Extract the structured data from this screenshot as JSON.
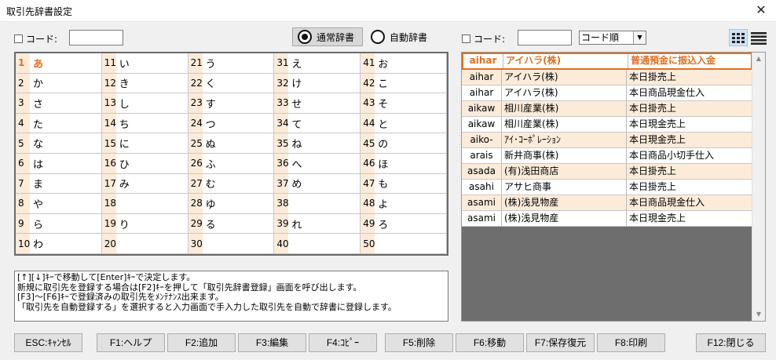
{
  "window": {
    "title": "取引先辞書設定",
    "close": "✕"
  },
  "left_filter": {
    "label": "コード:",
    "value": ""
  },
  "mode": {
    "normal": "通常辞書",
    "auto": "自動辞書"
  },
  "right_filter": {
    "label": "コード:",
    "value": "",
    "sort": "コード順"
  },
  "kana_columns": [
    [
      {
        "n": "1",
        "k": "あ"
      },
      {
        "n": "2",
        "k": "か"
      },
      {
        "n": "3",
        "k": "さ"
      },
      {
        "n": "4",
        "k": "た"
      },
      {
        "n": "5",
        "k": "な"
      },
      {
        "n": "6",
        "k": "は"
      },
      {
        "n": "7",
        "k": "ま"
      },
      {
        "n": "8",
        "k": "や"
      },
      {
        "n": "9",
        "k": "ら"
      },
      {
        "n": "10",
        "k": "わ"
      }
    ],
    [
      {
        "n": "11",
        "k": "い"
      },
      {
        "n": "12",
        "k": "き"
      },
      {
        "n": "13",
        "k": "し"
      },
      {
        "n": "14",
        "k": "ち"
      },
      {
        "n": "15",
        "k": "に"
      },
      {
        "n": "16",
        "k": "ひ"
      },
      {
        "n": "17",
        "k": "み"
      },
      {
        "n": "18",
        "k": ""
      },
      {
        "n": "19",
        "k": "り"
      },
      {
        "n": "20",
        "k": ""
      }
    ],
    [
      {
        "n": "21",
        "k": "う"
      },
      {
        "n": "22",
        "k": "く"
      },
      {
        "n": "23",
        "k": "す"
      },
      {
        "n": "24",
        "k": "つ"
      },
      {
        "n": "25",
        "k": "ぬ"
      },
      {
        "n": "26",
        "k": "ふ"
      },
      {
        "n": "27",
        "k": "む"
      },
      {
        "n": "28",
        "k": "ゆ"
      },
      {
        "n": "29",
        "k": "る"
      },
      {
        "n": "30",
        "k": ""
      }
    ],
    [
      {
        "n": "31",
        "k": "え"
      },
      {
        "n": "32",
        "k": "け"
      },
      {
        "n": "33",
        "k": "せ"
      },
      {
        "n": "34",
        "k": "て"
      },
      {
        "n": "35",
        "k": "ね"
      },
      {
        "n": "36",
        "k": "へ"
      },
      {
        "n": "37",
        "k": "め"
      },
      {
        "n": "38",
        "k": ""
      },
      {
        "n": "39",
        "k": "れ"
      },
      {
        "n": "40",
        "k": ""
      }
    ],
    [
      {
        "n": "41",
        "k": "お"
      },
      {
        "n": "42",
        "k": "こ"
      },
      {
        "n": "43",
        "k": "そ"
      },
      {
        "n": "44",
        "k": "と"
      },
      {
        "n": "45",
        "k": "の"
      },
      {
        "n": "46",
        "k": "ほ"
      },
      {
        "n": "47",
        "k": "も"
      },
      {
        "n": "48",
        "k": "よ"
      },
      {
        "n": "49",
        "k": "ろ"
      },
      {
        "n": "50",
        "k": ""
      }
    ]
  ],
  "list_header": {
    "code": "aihar",
    "name": "アイハラ(株)",
    "desc": "普通預金に振込入金"
  },
  "list_rows": [
    {
      "code": "aihar",
      "name": "アイハラ(株)",
      "desc": "本日掛売上"
    },
    {
      "code": "aihar",
      "name": "アイハラ(株)",
      "desc": "本日商品現金仕入"
    },
    {
      "code": "aikaw",
      "name": "相川産業(株)",
      "desc": "本日掛売上"
    },
    {
      "code": "aikaw",
      "name": "相川産業(株)",
      "desc": "本日現金売上"
    },
    {
      "code": "aiko-",
      "name": "ｱｲ･ｺｰﾎﾟﾚｰｼｮﾝ",
      "desc": "本日現金売上"
    },
    {
      "code": "arais",
      "name": "新井商事(株)",
      "desc": "本日商品小切手仕入"
    },
    {
      "code": "asada",
      "name": "(有)浅田商店",
      "desc": "本日掛売上"
    },
    {
      "code": "asahi",
      "name": "アサヒ商事",
      "desc": "本日掛売上"
    },
    {
      "code": "asami",
      "name": "(株)浅見物産",
      "desc": "本日商品現金仕入"
    },
    {
      "code": "asami",
      "name": "(株)浅見物産",
      "desc": "本日現金売上"
    }
  ],
  "help_lines": [
    "[↑][↓]ｷｰで移動して[Enter]ｷｰで決定します。",
    "新規に取引先を登録する場合は[F2]ｷｰを押して「取引先辞書登録」画面を呼び出します。",
    "[F3]～[F6]ｷｰで登録済みの取引先をﾒﾝﾃﾅﾝｽ出来ます。",
    "「取引先を自動登録する」を選択すると入力画面で手入力した取引先を自動で辞書に登録します。"
  ],
  "buttons": {
    "esc": "ESC:ｷｬﾝｾﾙ",
    "f1": "F1:ヘルプ",
    "f2": "F2:追加",
    "f3": "F3:編集",
    "f4": "F4:ｺﾋﾟｰ",
    "f5": "F5:削除",
    "f6": "F6:移動",
    "f7": "F7:保存復元",
    "f8": "F8:印刷",
    "f12": "F12:閉じる"
  },
  "colors": {
    "accent": "#e07020",
    "row_tint": "#fdebd9",
    "list_bg": "#6e6e6e"
  },
  "icons": [
    "close-icon",
    "grid-view-icon",
    "list-view-icon",
    "dropdown-arrow-icon",
    "scroll-up-icon",
    "scroll-down-icon"
  ]
}
